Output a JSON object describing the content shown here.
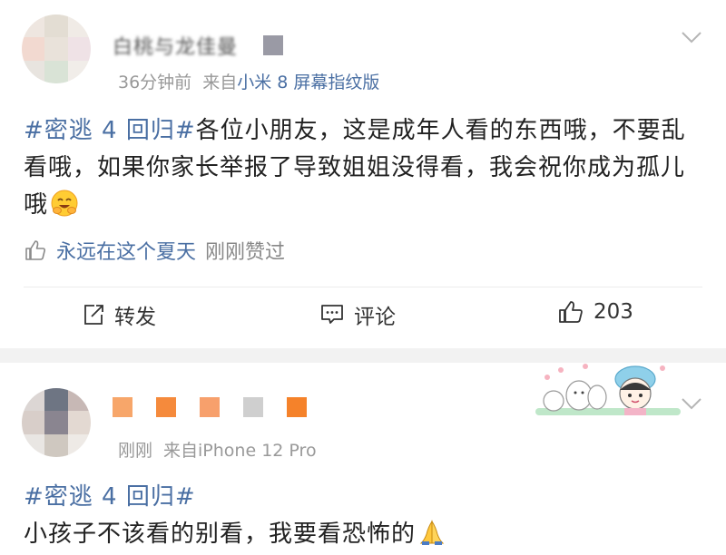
{
  "posts": [
    {
      "author": "白桃与龙佳曼",
      "time": "36分钟前",
      "from_label": "来自",
      "source": "小米 8 屏幕指纹版",
      "topic": "#密逃 4 回归#",
      "text": "各位小朋友，这是成年人看的东西哦，不要乱看哦，如果你家长举报了导致姐姐没得看，我会祝你成为孤儿哦",
      "emoji": "smiling-face-with-hands-icon",
      "liked_by": "永远在这个夏天",
      "liked_text": "刚刚赞过",
      "actions": {
        "repost": "转发",
        "comment": "评论",
        "like": "203"
      }
    },
    {
      "time": "刚刚",
      "from_label": "来自",
      "source": "iPhone 12 Pro",
      "topic": "#密逃 4 回归#",
      "text": "小孩子不该看的别看，我要看恐怖的",
      "emoji": "folded-hands-icon"
    }
  ],
  "colors": {
    "link": "#4a6fa3",
    "meta": "#999999",
    "name_pixels": [
      "#f7a66a",
      "#f58a3c",
      "#f7a06c",
      "#cfcfcf",
      "#f5822a"
    ]
  }
}
